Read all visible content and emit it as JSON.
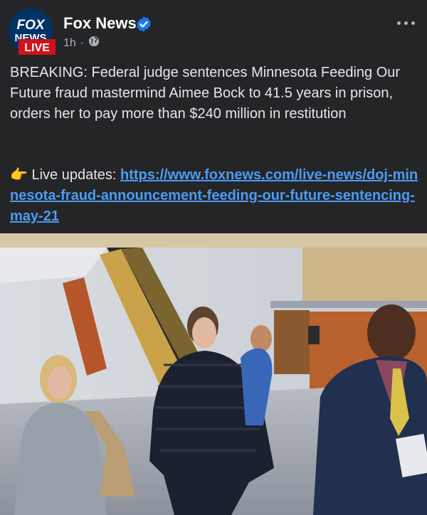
{
  "post": {
    "page_name": "Fox News",
    "time": "1h",
    "separator": "·",
    "avatar_text": {
      "line1": "FOX",
      "line2": "NEWS",
      "line3": "LIVE"
    },
    "body": "BREAKING: Federal judge sentences Minnesota Feeding Our Future fraud mastermind Aimee Bock to 41.5 years in prison, orders her to pay more than $240 million in restitution",
    "updates_label": "Live updates:",
    "updates_link": "https://www.foxnews.com/live-news/doj-minnesota-fraud-announcement-feeding-our-future-sentencing-may-21",
    "pointing_emoji": "👉"
  },
  "colors": {
    "link": "#4d9bf5",
    "background": "#242526",
    "fox_red": "#d0121b",
    "fox_blue": "#003366",
    "verified": "#1877f2"
  },
  "icons": {
    "visibility": "globe-icon",
    "verified": "verified-badge-icon",
    "more": "more-options-icon"
  }
}
